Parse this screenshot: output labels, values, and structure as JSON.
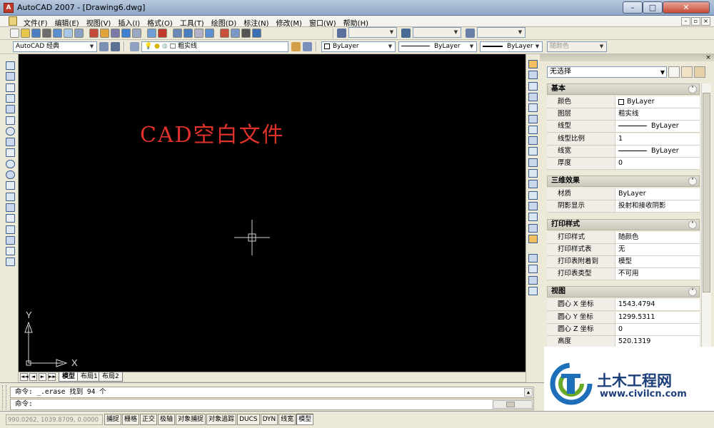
{
  "window": {
    "title": "AutoCAD 2007 - [Drawing6.dwg]",
    "minimize_icon": "minimize-icon",
    "maximize_icon": "maximize-icon",
    "close_icon": "close-icon",
    "min_glyph": "–",
    "max_glyph": "□",
    "close_glyph": "✕"
  },
  "menubar": {
    "items": [
      "文件(F)",
      "编辑(E)",
      "视图(V)",
      "插入(I)",
      "格式(O)",
      "工具(T)",
      "绘图(D)",
      "标注(N)",
      "修改(M)",
      "窗口(W)",
      "帮助(H)"
    ],
    "mdi_min": "–",
    "mdi_max": "▫",
    "mdi_close": "×"
  },
  "toolbar": {
    "workspace": "AutoCAD 经典",
    "layer": "粗实线",
    "color": "ByLayer",
    "linetype": "ByLayer",
    "lineweight": "ByLayer",
    "plotstyle": "随颜色",
    "dropdown_glyph": "▼"
  },
  "canvas": {
    "text": "CAD空白文件",
    "text_color": "#e0312a",
    "background": "#000000",
    "ucs_x_label": "X",
    "ucs_y_label": "Y"
  },
  "layout_tabs": {
    "nav": [
      "◄◄",
      "◄",
      "►",
      "►►"
    ],
    "tabs": [
      "模型",
      "布局1",
      "布局2"
    ],
    "active": "模型"
  },
  "properties": {
    "selection": "无选择",
    "close_glyph": "×",
    "sections": [
      {
        "title": "基本",
        "rows": [
          {
            "label": "颜色",
            "value": "ByLayer",
            "kind": "swatch"
          },
          {
            "label": "图层",
            "value": "粗实线",
            "kind": "text"
          },
          {
            "label": "线型",
            "value": "ByLayer",
            "kind": "line"
          },
          {
            "label": "线型比例",
            "value": "1",
            "kind": "text"
          },
          {
            "label": "线宽",
            "value": "ByLayer",
            "kind": "line"
          },
          {
            "label": "厚度",
            "value": "0",
            "kind": "text"
          }
        ]
      },
      {
        "title": "三维效果",
        "rows": [
          {
            "label": "材质",
            "value": "ByLayer",
            "kind": "text"
          },
          {
            "label": "阴影显示",
            "value": "投射和接收阴影",
            "kind": "text"
          }
        ]
      },
      {
        "title": "打印样式",
        "rows": [
          {
            "label": "打印样式",
            "value": "随颜色",
            "kind": "text"
          },
          {
            "label": "打印样式表",
            "value": "无",
            "kind": "text"
          },
          {
            "label": "打印表附着到",
            "value": "模型",
            "kind": "text"
          },
          {
            "label": "打印表类型",
            "value": "不可用",
            "kind": "text"
          }
        ]
      },
      {
        "title": "视图",
        "rows": [
          {
            "label": "圆心 X 坐标",
            "value": "1543.4794",
            "kind": "text"
          },
          {
            "label": "圆心 Y 坐标",
            "value": "1299.5311",
            "kind": "text"
          },
          {
            "label": "圆心 Z 坐标",
            "value": "0",
            "kind": "text"
          },
          {
            "label": "高度",
            "value": "520.1319",
            "kind": "text"
          }
        ]
      }
    ],
    "collapse_glyph": "˄"
  },
  "command": {
    "line1": "命令:  _.erase 找到 94 个",
    "line2": "命令:",
    "scroll_up": "▲",
    "scroll_down": "▼"
  },
  "status": {
    "coords": "990.0262, 1039.8709, 0.0000",
    "buttons": [
      "捕捉",
      "栅格",
      "正交",
      "极轴",
      "对象捕捉",
      "对象追踪",
      "DUCS",
      "DYN",
      "线宽",
      "模型"
    ]
  },
  "watermark": {
    "title": "土木工程网",
    "url": "www.civilcn.com",
    "color": "#1c3f7a"
  }
}
